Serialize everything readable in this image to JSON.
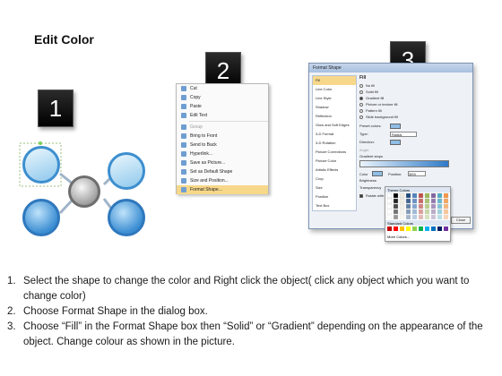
{
  "title": "Edit Color",
  "steps": [
    "1",
    "2",
    "3"
  ],
  "context_menu": {
    "items": [
      "Cut",
      "Copy",
      "Paste",
      "Edit Text",
      "Group",
      "Bring to Front",
      "Send to Back",
      "Hyperlink...",
      "Save as Picture...",
      "Set as Default Shape",
      "Size and Position...",
      "Format Shape..."
    ]
  },
  "format_dialog": {
    "title": "Format Shape",
    "categories": [
      "Fill",
      "Line Color",
      "Line Style",
      "Shadow",
      "Reflection",
      "Glow and Soft Edges",
      "3-D Format",
      "3-D Rotation",
      "Picture Corrections",
      "Picture Color",
      "Artistic Effects",
      "Crop",
      "Size",
      "Position",
      "Text Box",
      "Alt Text"
    ],
    "section": "Fill",
    "fill_options": [
      "No fill",
      "Solid fill",
      "Gradient fill",
      "Picture or texture fill",
      "Pattern fill",
      "Slide background fill"
    ],
    "labels": [
      "Preset colors:",
      "Type:",
      "Direction:",
      "Angle:",
      "Gradient stops",
      "Color",
      "Position:",
      "Brightness",
      "Transparency",
      "Rotate with shape"
    ],
    "type_value": "Radial",
    "position_value": "36%",
    "close_label": "Close",
    "palette_theme": "Theme Colors",
    "palette_standard": "Standard Colors",
    "palette_more": "More Colors..."
  },
  "instructions": [
    {
      "num": "1.",
      "text": "Select the shape to change the color and Right click the object( click any object which you want to change color)"
    },
    {
      "num": "2.",
      "text": "Choose Format Shape in the dialog box."
    },
    {
      "num": "3.",
      "text": "Choose “Fill” in the Format Shape box then “Solid” or “Gradient” depending on the appearance of the object. Change colour as shown in the picture."
    }
  ]
}
